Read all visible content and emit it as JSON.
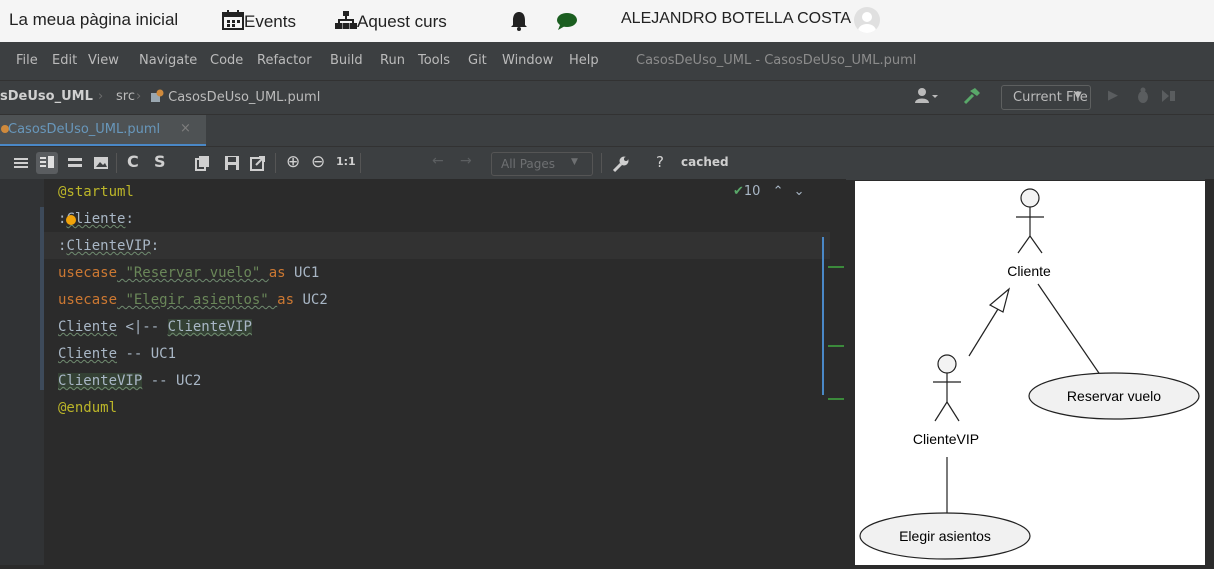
{
  "topbar": {
    "home": "La meua pàgina inicial",
    "events": "Events",
    "course": "Aquest curs",
    "user": "ALEJANDRO BOTELLA COSTA"
  },
  "menu": {
    "items": [
      "File",
      "Edit",
      "View",
      "Navigate",
      "Code",
      "Refactor",
      "Build",
      "Run",
      "Tools",
      "Git",
      "Window",
      "Help"
    ],
    "window_title": "CasosDeUso_UML - CasosDeUso_UML.puml"
  },
  "nav": {
    "project": "sDeUso_UML",
    "folder": "src",
    "file": "CasosDeUso_UML.puml",
    "run_config": "Current File"
  },
  "tab": {
    "label": "CasosDeUso_UML.puml"
  },
  "toolbar": {
    "zoom_reset": "1:1",
    "pages": "All Pages",
    "help": "?",
    "status": "cached"
  },
  "editor": {
    "inspection_count": "10",
    "lines": {
      "l1": "@startuml",
      "l2a": ":",
      "l2b": "Cliente",
      "l2c": ":",
      "l3a": ":",
      "l3b": "ClienteVIP",
      "l3c": ":",
      "l4a": "usecase",
      "l4b": " \"Reservar vuelo\" ",
      "l4c": "as",
      "l4d": " UC1",
      "l5a": "usecase",
      "l5b": " \"Elegir asientos\" ",
      "l5c": "as",
      "l5d": " UC2",
      "l6a": "Cliente",
      "l6b": " <|-- ",
      "l6c": "ClienteVIP",
      "l7a": "Cliente",
      "l7b": " -- UC1",
      "l8a": "ClienteVIP",
      "l8b": " -- UC2",
      "l9": "@enduml"
    }
  },
  "diagram": {
    "actor1": "Cliente",
    "actor2": "ClienteVIP",
    "uc1": "Reservar vuelo",
    "uc2": "Elegir asientos"
  },
  "colors": {
    "keyword": "#cc7832",
    "string": "#6a8759",
    "annotation": "#bbb529",
    "text": "#a9b7c6",
    "accent": "#4a88c7"
  }
}
